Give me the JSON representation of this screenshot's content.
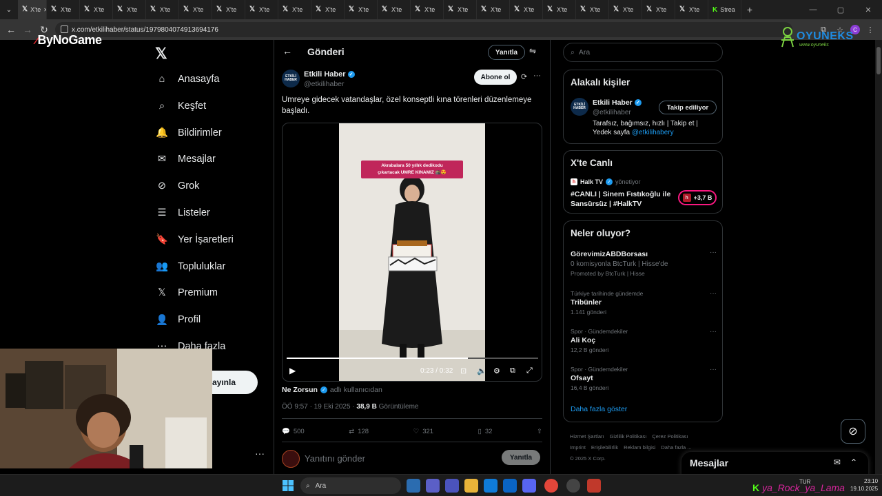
{
  "browser": {
    "tabs": [
      "X'te",
      "X'te",
      "X'te",
      "X'te",
      "X'te",
      "X'te",
      "X'te",
      "X'te",
      "X'te",
      "X'te",
      "X'te",
      "X'te",
      "X'te",
      "X'te",
      "X'te",
      "X'te",
      "X'te",
      "X'te",
      "X'te",
      "X'te",
      "X'te",
      "Strea"
    ],
    "url": "x.com/etkilihaber/status/1979804074913694176",
    "profile_initial": "C"
  },
  "overlay": {
    "brand_left": "ByNoGame",
    "brand_right": "OYUNEKS",
    "brand_right_sub": "www.oyuneks",
    "ticker_text": "ya_Rock_ya_Lama"
  },
  "nav": {
    "items": [
      "Anasayfa",
      "Keşfet",
      "Bildirimler",
      "Mesajlar",
      "Grok",
      "Listeler",
      "Yer İşaretleri",
      "Topluluklar",
      "Premium",
      "Profil",
      "Daha fazla"
    ],
    "post_label": "ayınla"
  },
  "post": {
    "header_title": "Gönderi",
    "reply_pill": "Yanıtla",
    "author_name": "Etkili Haber",
    "author_handle": "@etkilihaber",
    "avatar_text": "ETKİLİ HABER",
    "subscribe_label": "Abone ol",
    "text": "Umreye gidecek vatandaşlar, özel konseptli kına törenleri düzenlemeye başladı.",
    "video_banner_line1": "Akrabalara 50 yıllık dedikodu",
    "video_banner_line2": "çıkartacak UMRE KINAMIZ 🕋😍",
    "video_time": "0:23 / 0:32",
    "progress_fraction": 0.72,
    "tagged_user": "Ne Zorsun",
    "tagged_suffix": "adlı kullanıcıdan",
    "timestamp": "ÖÖ 9:57 · 19 Eki 2025 ·",
    "views_count": "38,9 B",
    "views_label": "Görüntüleme",
    "stats": {
      "replies": "500",
      "reposts": "128",
      "likes": "321",
      "bookmarks": "32"
    },
    "reply_placeholder": "Yanıtını gönder",
    "reply_button": "Yanıtla"
  },
  "right": {
    "search_placeholder": "Ara",
    "related": {
      "title": "Alakalı kişiler",
      "name": "Etkili Haber",
      "handle": "@etkilihaber",
      "follow_label": "Takip ediliyor",
      "bio": "Tarafsız, bağımsız, hızlı | Takip et | Yedek sayfa ",
      "bio_link": "@etkilihabery"
    },
    "live": {
      "title": "X'te Canlı",
      "host": "Halk TV",
      "host_role": "yönetiyor",
      "stream_title": "#CANLI | Sinem Fıstıkoğlu ile Sansürsüz | #HalkTV",
      "listeners": "+3,7 B"
    },
    "trends": {
      "title": "Neler oluyor?",
      "items": [
        {
          "context": "",
          "title": "GörevimizABDBorsası",
          "sub": "0 komisyonla BtcTurk | Hisse'de",
          "count": "Promoted by BtcTurk | Hisse"
        },
        {
          "context": "Türkiye tarihinde gündemde",
          "title": "Tribünler",
          "sub": "",
          "count": "1.141 gönderi"
        },
        {
          "context": "Spor · Gündemdekiler",
          "title": "Ali Koç",
          "sub": "",
          "count": "12,2 B gönderi"
        },
        {
          "context": "Spor · Gündemdekiler",
          "title": "Ofsayt",
          "sub": "",
          "count": "16,4 B gönderi"
        }
      ],
      "show_more": "Daha fazla göster"
    },
    "footer": [
      "Hizmet Şartları",
      "Gizlilik Politikası",
      "Çerez Politikası",
      "Imprint",
      "Erişilebilirlik",
      "Reklam bilgisi",
      "Daha fazla ...",
      "© 2025 X Corp."
    ],
    "messages_title": "Mesajlar"
  },
  "taskbar": {
    "search_label": "Ara",
    "tray_lang": "TUR",
    "clock_time": "23:10",
    "clock_date": "19.10.2025"
  }
}
